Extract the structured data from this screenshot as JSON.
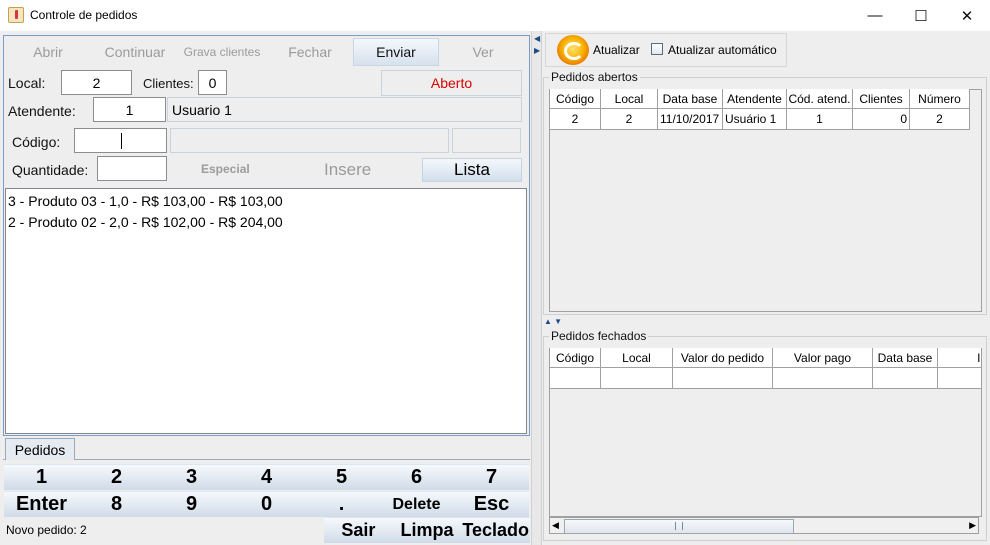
{
  "window": {
    "title": "Controle de pedidos",
    "minimize": "—",
    "maximize": "☐",
    "close": "✕"
  },
  "toolbar": {
    "abrir": "Abrir",
    "continuar": "Continuar",
    "grava_clientes": "Grava clientes",
    "fechar": "Fechar",
    "enviar": "Enviar",
    "ver": "Ver"
  },
  "form": {
    "local_label": "Local:",
    "local_value": "2",
    "clientes_label": "Clientes:",
    "clientes_value": "0",
    "status": "Aberto",
    "atendente_label": "Atendente:",
    "atendente_value": "1",
    "atendente_name": "Usuario 1",
    "codigo_label": "Código:",
    "codigo_value": "",
    "quantidade_label": "Quantidade:",
    "quantidade_value": "",
    "especial": "Especial",
    "insere": "Insere",
    "lista": "Lista"
  },
  "order_items": [
    "3 - Produto 03 - 1,0 - R$ 103,00 - R$ 103,00",
    "2 - Produto 02 - 2,0 - R$ 102,00 - R$ 204,00"
  ],
  "tab_label": "Pedidos",
  "keypad": {
    "row1": [
      "1",
      "2",
      "3",
      "4",
      "5",
      "6",
      "7"
    ],
    "row2": [
      "Enter",
      "8",
      "9",
      "0",
      ".",
      "Delete",
      "Esc"
    ]
  },
  "status_bar": "Novo pedido: 2",
  "bottom_buttons": [
    "Sair",
    "Limpa",
    "Teclado"
  ],
  "right_toolbar": {
    "refresh": "Atualizar",
    "auto_refresh": "Atualizar automático"
  },
  "pedidos_abertos": {
    "title": "Pedidos abertos",
    "columns": [
      "Código",
      "Local",
      "Data base",
      "Atendente",
      "Cód. atend.",
      "Clientes",
      "Número"
    ],
    "rows": [
      [
        "2",
        "2",
        "11/10/2017",
        "Usuário 1",
        "1",
        "0",
        "2"
      ]
    ]
  },
  "pedidos_fechados": {
    "title": "Pedidos fechados",
    "columns": [
      "Código",
      "Local",
      "Valor do pedido",
      "Valor pago",
      "Data base",
      "I"
    ]
  },
  "colors": {
    "status_red": "#dd0000",
    "accent_border": "#7a9cc8"
  }
}
